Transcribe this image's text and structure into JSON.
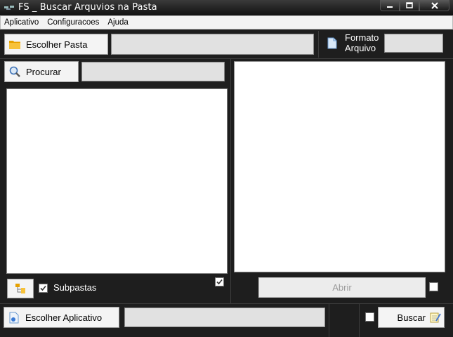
{
  "window": {
    "title": "FS _ Buscar Arquvios na Pasta"
  },
  "menu": [
    "Aplicativo",
    "Configuracoes",
    "Ajuda"
  ],
  "toolbar": {
    "choose_folder_label": "Escolher Pasta",
    "folder_path_value": "",
    "format_label_line1": "Formato",
    "format_label_line2": "Arquivo",
    "format_value": ""
  },
  "search": {
    "label": "Procurar",
    "value": ""
  },
  "left_panel": {
    "subfolders_label": "Subpastas",
    "subfolders_checked": true,
    "extra_checked": true
  },
  "right_panel": {
    "open_label": "Abrir",
    "open_checked": false
  },
  "bottom": {
    "choose_app_label": "Escolher Aplicativo",
    "app_path_value": "",
    "search_checked": false,
    "search_label": "Buscar"
  },
  "colors": {
    "folder": "#f0a800",
    "magnifier": "#3a6fb5",
    "background": "#1e1e1e"
  }
}
